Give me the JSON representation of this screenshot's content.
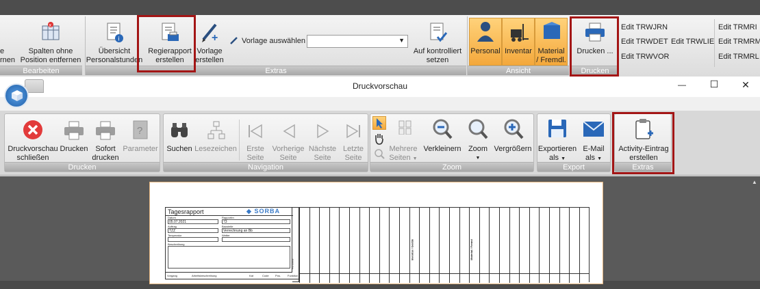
{
  "top_ribbon": {
    "partial_left_1": "e",
    "partial_left_2": "rnen",
    "spalten_label_1": "Spalten ohne",
    "spalten_label_2": "Position entfernen",
    "bearbeiten_group": "Bearbeiten",
    "uebersicht_1": "Übersicht",
    "uebersicht_2": "Personalstunden",
    "regie_1": "Regierapport",
    "regie_2": "erstellen",
    "vorlage_1": "Vorlage",
    "vorlage_2": "erstellen",
    "vorlage_auswaehlen": "Vorlage auswählen",
    "auf_1": "Auf kontrolliert",
    "auf_2": "setzen",
    "extras_group": "Extras",
    "personal": "Personal",
    "inventar": "Inventar",
    "material_1": "Material",
    "material_2": "/ Fremdl.",
    "ansicht_group": "Ansicht",
    "drucken_btn": "Drucken ...",
    "drucken_group": "Drucken",
    "edit_items": [
      "Edit TRWJRN",
      "Edit TRWDET",
      "Edit TRWLIE",
      "Edit TRWVOR",
      "Edit TRMRI",
      "Edit TRMRM",
      "Edit TRMRL"
    ]
  },
  "window": {
    "title": "Druckvorschau",
    "minimize": "—",
    "maximize": "☐",
    "close": "✕"
  },
  "preview_ribbon": {
    "schliessen_1": "Druckvorschau",
    "schliessen_2": "schließen",
    "drucken": "Drucken",
    "sofort_1": "Sofort",
    "sofort_2": "drucken",
    "parameter": "Parameter",
    "drucken_group": "Drucken",
    "suchen": "Suchen",
    "lesezeichen": "Lesezeichen",
    "erste_1": "Erste",
    "erste_2": "Seite",
    "vorherige_1": "Vorherige",
    "vorherige_2": "Seite",
    "naechste_1": "Nächste",
    "naechste_2": "Seite",
    "letzte_1": "Letzte",
    "letzte_2": "Seite",
    "navigation_group": "Navigation",
    "mehrere_1": "Mehrere",
    "mehrere_2": "Seiten",
    "verkleinern": "Verkleinern",
    "zoom": "Zoom",
    "vergroessern": "Vergrößern",
    "zoom_group": "Zoom",
    "exportieren_1": "Exportieren",
    "exportieren_2": "als",
    "email_1": "E-Mail",
    "email_2": "als",
    "export_group": "Export",
    "activity_1": "Activity-Eintrag",
    "activity_2": "erstellen",
    "extras_group": "Extras"
  },
  "document": {
    "title": "Tagesrapport",
    "logo": "SORBA",
    "date_label": "Datum",
    "date_value": "05.07.2021",
    "rapport_label": "Rapportnr.",
    "rapport_value": "73",
    "auftrag_label": "Auftrag",
    "auftrag_value": "TZZ",
    "baustelle_label": "Baustelle",
    "baustelle_value": "Verrechnung an Bb",
    "temperatur_label": "Temperatur",
    "wetter_label": "Wetter",
    "beschreibung_label": "Beschreibung",
    "col_vorgang": "Vorgang",
    "col_arbeit": "Arbeitsbeschreibung",
    "col_kat": "Kat",
    "col_code": "Code",
    "col_pos": "Pos.",
    "col_funktion": "Funktion",
    "personal_vert": "Personal",
    "inventar_vert": "Inventar / Geräte",
    "material_vert": "Material / Fremd"
  }
}
